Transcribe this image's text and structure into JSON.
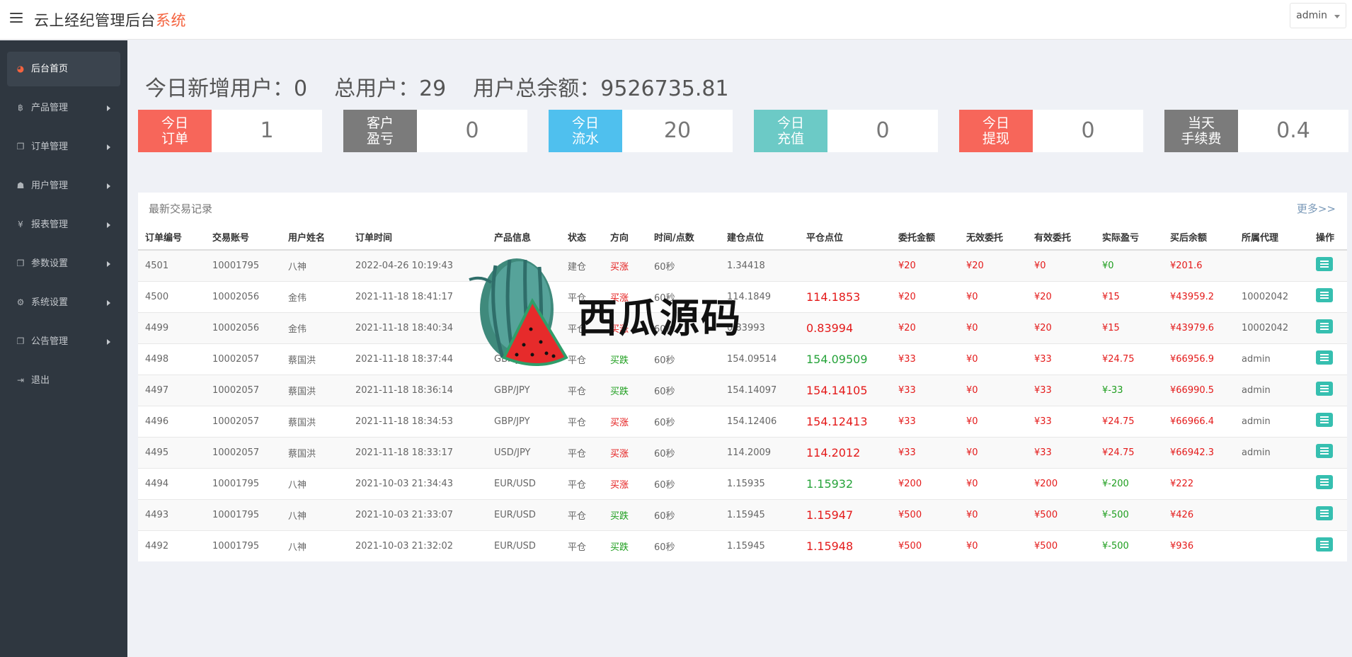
{
  "header": {
    "brand_main": "云上经纪管理后台",
    "brand_accent": "系统",
    "user": "admin"
  },
  "sidebar": {
    "items": [
      {
        "label": "后台首页",
        "icon": "dashboard-icon",
        "glyph": "◕"
      },
      {
        "label": "产品管理",
        "icon": "bitcoin-icon",
        "glyph": "฿"
      },
      {
        "label": "订单管理",
        "icon": "copy-icon",
        "glyph": "❐"
      },
      {
        "label": "用户管理",
        "icon": "user-icon",
        "glyph": "☗"
      },
      {
        "label": "报表管理",
        "icon": "yen-icon",
        "glyph": "¥"
      },
      {
        "label": "参数设置",
        "icon": "copy-icon",
        "glyph": "❐"
      },
      {
        "label": "系统设置",
        "icon": "cogs-icon",
        "glyph": "⚙"
      },
      {
        "label": "公告管理",
        "icon": "copy-icon",
        "glyph": "❐"
      },
      {
        "label": "退出",
        "icon": "sign-out-icon",
        "glyph": "⇥"
      }
    ]
  },
  "summary": {
    "new_users": "今日新增用户：0",
    "total_users": "总用户：29",
    "total_balance": "用户总余额：9526735.81"
  },
  "cards": [
    {
      "label1": "今日",
      "label2": "订单",
      "value": "1",
      "color": "#f7665a"
    },
    {
      "label1": "客户",
      "label2": "盈亏",
      "value": "0",
      "color": "#7b7b7b"
    },
    {
      "label1": "今日",
      "label2": "流水",
      "value": "20",
      "color": "#4fc0ee"
    },
    {
      "label1": "今日",
      "label2": "充值",
      "value": "0",
      "color": "#6ccac6"
    },
    {
      "label1": "今日",
      "label2": "提现",
      "value": "0",
      "color": "#f7665a"
    },
    {
      "label1": "当天",
      "label2": "手续费",
      "value": "0.4",
      "color": "#7b7b7b"
    }
  ],
  "records": {
    "title": "最新交易记录",
    "more": "更多>>",
    "columns": [
      "订单编号",
      "交易账号",
      "用户姓名",
      "订单时间",
      "产品信息",
      "状态",
      "方向",
      "时间/点数",
      "建仓点位",
      "平仓点位",
      "委托金额",
      "无效委托",
      "有效委托",
      "实际盈亏",
      "买后余额",
      "所属代理",
      "操作"
    ],
    "rows": [
      [
        "4501",
        "10001795",
        "八神",
        "2022-04-26 10:19:43",
        "",
        "建仓",
        "买涨",
        "60秒",
        "1.34418",
        "",
        "¥20",
        "¥20",
        "¥0",
        "¥0",
        "¥201.6",
        ""
      ],
      [
        "4500",
        "10002056",
        "金伟",
        "2021-11-18 18:41:17",
        "",
        "平仓",
        "买涨",
        "60秒",
        "114.1849",
        "114.1853",
        "¥20",
        "¥0",
        "¥20",
        "¥15",
        "¥43959.2",
        "10002042"
      ],
      [
        "4499",
        "10002056",
        "金伟",
        "2021-11-18 18:40:34",
        "",
        "平仓",
        "买涨",
        "60秒",
        "0.83993",
        "0.83994",
        "¥20",
        "¥0",
        "¥20",
        "¥15",
        "¥43979.6",
        "10002042"
      ],
      [
        "4498",
        "10002057",
        "蔡国洪",
        "2021-11-18 18:37:44",
        "GBP/JPY",
        "平仓",
        "买跌",
        "60秒",
        "154.09514",
        "154.09509",
        "¥33",
        "¥0",
        "¥33",
        "¥24.75",
        "¥66956.9",
        "admin"
      ],
      [
        "4497",
        "10002057",
        "蔡国洪",
        "2021-11-18 18:36:14",
        "GBP/JPY",
        "平仓",
        "买跌",
        "60秒",
        "154.14097",
        "154.14105",
        "¥33",
        "¥0",
        "¥33",
        "¥-33",
        "¥66990.5",
        "admin"
      ],
      [
        "4496",
        "10002057",
        "蔡国洪",
        "2021-11-18 18:34:53",
        "GBP/JPY",
        "平仓",
        "买涨",
        "60秒",
        "154.12406",
        "154.12413",
        "¥33",
        "¥0",
        "¥33",
        "¥24.75",
        "¥66966.4",
        "admin"
      ],
      [
        "4495",
        "10002057",
        "蔡国洪",
        "2021-11-18 18:33:17",
        "USD/JPY",
        "平仓",
        "买涨",
        "60秒",
        "114.2009",
        "114.2012",
        "¥33",
        "¥0",
        "¥33",
        "¥24.75",
        "¥66942.3",
        "admin"
      ],
      [
        "4494",
        "10001795",
        "八神",
        "2021-10-03 21:34:43",
        "EUR/USD",
        "平仓",
        "买涨",
        "60秒",
        "1.15935",
        "1.15932",
        "¥200",
        "¥0",
        "¥200",
        "¥-200",
        "¥222",
        ""
      ],
      [
        "4493",
        "10001795",
        "八神",
        "2021-10-03 21:33:07",
        "EUR/USD",
        "平仓",
        "买跌",
        "60秒",
        "1.15945",
        "1.15947",
        "¥500",
        "¥0",
        "¥500",
        "¥-500",
        "¥426",
        ""
      ],
      [
        "4492",
        "10001795",
        "八神",
        "2021-10-03 21:32:02",
        "EUR/USD",
        "平仓",
        "买跌",
        "60秒",
        "1.15945",
        "1.15948",
        "¥500",
        "¥0",
        "¥500",
        "¥-500",
        "¥936",
        ""
      ]
    ]
  },
  "watermark": {
    "text": "西瓜源码"
  },
  "colors": {
    "accent": "#f4633f",
    "up": "#e41a1a",
    "down": "#1e9e1e",
    "sidebar": "#2f3740",
    "action": "#36bfb0"
  }
}
